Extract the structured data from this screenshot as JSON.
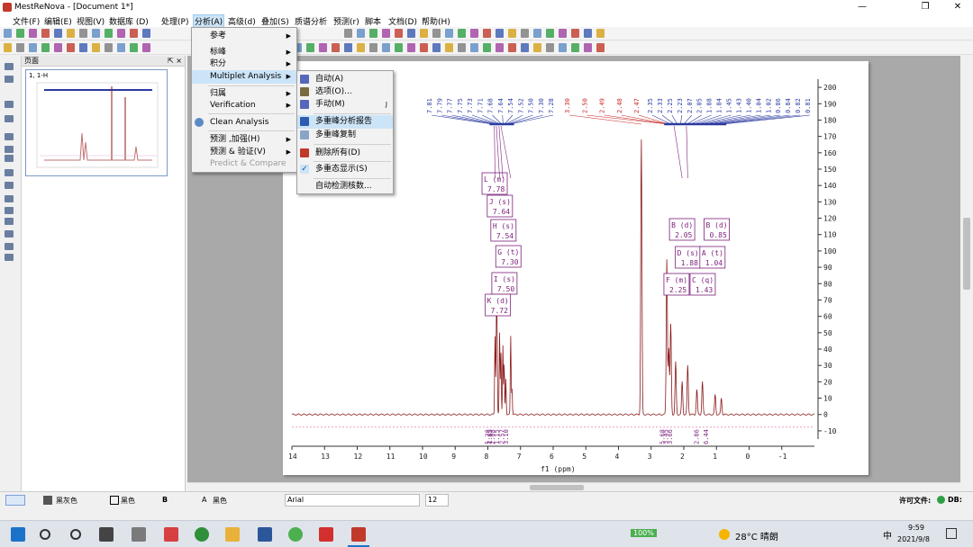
{
  "window": {
    "title": "MestReNova - [Document 1*]",
    "controls": [
      "—",
      "❐",
      "✕"
    ]
  },
  "menubar": [
    {
      "label": "文件(F)"
    },
    {
      "label": "编辑(E)"
    },
    {
      "label": "视图(V)"
    },
    {
      "label": "数据库 (D)"
    },
    {
      "label": "处理(P)"
    },
    {
      "label": "分析(A)"
    },
    {
      "label": "高级(d)"
    },
    {
      "label": "叠加(S)"
    },
    {
      "label": "质谱分析"
    },
    {
      "label": "预测(r)"
    },
    {
      "label": "脚本"
    },
    {
      "label": "文档(D)"
    },
    {
      "label": "帮助(H)"
    }
  ],
  "page_panel": {
    "title": "页面",
    "controls": "⇱ ×",
    "thumb_label": "1, 1-H"
  },
  "analysis_menu": {
    "items": [
      {
        "label": "参考",
        "submenu": true
      },
      {
        "label": "标峰",
        "submenu": true
      },
      {
        "label": "积分",
        "submenu": true
      },
      {
        "label": "Multiplet Analysis",
        "submenu": true,
        "highlighted": true
      },
      {
        "label": "归属",
        "submenu": true
      },
      {
        "label": "Verification",
        "submenu": true
      },
      {
        "label": "Clean Analysis"
      },
      {
        "label": "预测 ,加强(H)",
        "submenu": true
      },
      {
        "label": "预测 & 验证(V)",
        "submenu": true
      },
      {
        "label": "Predict & Compare",
        "disabled": true
      }
    ]
  },
  "multiplet_menu": {
    "items": [
      {
        "label": "自动(A)",
        "icon": "auto-multiplet-icon"
      },
      {
        "label": "选项(O)...",
        "icon": "options-icon"
      },
      {
        "label": "手动(M)",
        "shortcut": "J",
        "icon": "manual-multiplet-icon"
      },
      {
        "label": "多重峰分析报告",
        "icon": "report-icon",
        "highlighted": true
      },
      {
        "label": "多重峰复制",
        "icon": "copy-icon"
      },
      {
        "label": "删除所有(D)",
        "icon": "delete-icon"
      },
      {
        "label": "多重态显示(S)",
        "icon": "check-icon",
        "checked": true
      },
      {
        "label": "自动检测核数..."
      }
    ]
  },
  "chart_data": {
    "type": "line",
    "xlabel": "f1 (ppm)",
    "xlim": [
      14,
      -2
    ],
    "ylim": [
      -15,
      205
    ],
    "x_ticks": [
      14,
      13,
      12,
      11,
      10,
      9,
      8,
      7,
      6,
      5,
      4,
      3,
      2,
      1,
      0,
      -1
    ],
    "y_ticks": [
      200,
      190,
      180,
      170,
      160,
      150,
      140,
      130,
      120,
      110,
      100,
      90,
      80,
      70,
      60,
      50,
      40,
      30,
      20,
      10,
      0,
      -10
    ],
    "series": [
      {
        "color": "#8b1a1a",
        "peaks": [
          {
            "x": 7.78,
            "h": 48
          },
          {
            "x": 7.74,
            "h": 45
          },
          {
            "x": 7.72,
            "h": 52
          },
          {
            "x": 7.64,
            "h": 50
          },
          {
            "x": 7.6,
            "h": 38
          },
          {
            "x": 7.54,
            "h": 42
          },
          {
            "x": 7.5,
            "h": 30
          },
          {
            "x": 7.45,
            "h": 22
          },
          {
            "x": 7.3,
            "h": 48
          },
          {
            "x": 7.26,
            "h": 16
          },
          {
            "x": 3.3,
            "h": 168
          },
          {
            "x": 2.52,
            "h": 95
          },
          {
            "x": 2.46,
            "h": 40
          },
          {
            "x": 2.4,
            "h": 55
          },
          {
            "x": 2.25,
            "h": 32
          },
          {
            "x": 2.05,
            "h": 20
          },
          {
            "x": 1.88,
            "h": 30
          },
          {
            "x": 1.6,
            "h": 15
          },
          {
            "x": 1.43,
            "h": 20
          },
          {
            "x": 1.04,
            "h": 12
          },
          {
            "x": 0.85,
            "h": 10
          }
        ]
      }
    ],
    "multiplets": [
      {
        "id": "L",
        "type": "m",
        "shift": "7.78"
      },
      {
        "id": "J",
        "type": "s",
        "shift": "7.64"
      },
      {
        "id": "H",
        "type": "s",
        "shift": "7.54"
      },
      {
        "id": "G",
        "type": "t",
        "shift": "7.30"
      },
      {
        "id": "I",
        "type": "s",
        "shift": "7.50"
      },
      {
        "id": "K",
        "type": "d",
        "shift": "7.72"
      },
      {
        "id": "B",
        "type": "d",
        "shift": "2.05"
      },
      {
        "id": "B",
        "type": "d",
        "shift": "0.85"
      },
      {
        "id": "D",
        "type": "s",
        "shift": "1.88"
      },
      {
        "id": "A",
        "type": "t",
        "shift": "1.04"
      },
      {
        "id": "F",
        "type": "m",
        "shift": "2.25"
      },
      {
        "id": "C",
        "type": "q",
        "shift": "1.43"
      }
    ],
    "integrals": [
      "5.28",
      "1.85",
      "2.08",
      "1.15",
      "2.57",
      "3.10",
      "5.68",
      "3.45",
      "3.66",
      "2.86",
      "6.44"
    ],
    "peak_labels_blue": [
      "7.81",
      "7.79",
      "7.77",
      "7.75",
      "7.73",
      "7.71",
      "7.68",
      "7.64",
      "7.54",
      "7.52",
      "7.50",
      "7.30",
      "7.28"
    ],
    "peak_labels_red": [
      "3.30",
      "2.50",
      "2.49",
      "2.48",
      "2.47"
    ],
    "peak_labels_blue_right": [
      "2.35",
      "2.33",
      "2.25",
      "2.23",
      "2.07",
      "2.05",
      "1.88",
      "1.84",
      "1.45",
      "1.43",
      "1.40",
      "1.04",
      "1.02",
      "0.86",
      "0.84",
      "0.82",
      "0.81"
    ]
  },
  "statusbar": {
    "color1": "黑灰色",
    "color2": "黑色",
    "color3": "黑色",
    "font": "Arial",
    "size": "12",
    "license": "许可文件:",
    "db": "DB:"
  },
  "taskbar": {
    "weather": "28°C 晴朗",
    "battery": "100%",
    "ime": "中",
    "time": "9:59",
    "date": "2021/9/8"
  }
}
